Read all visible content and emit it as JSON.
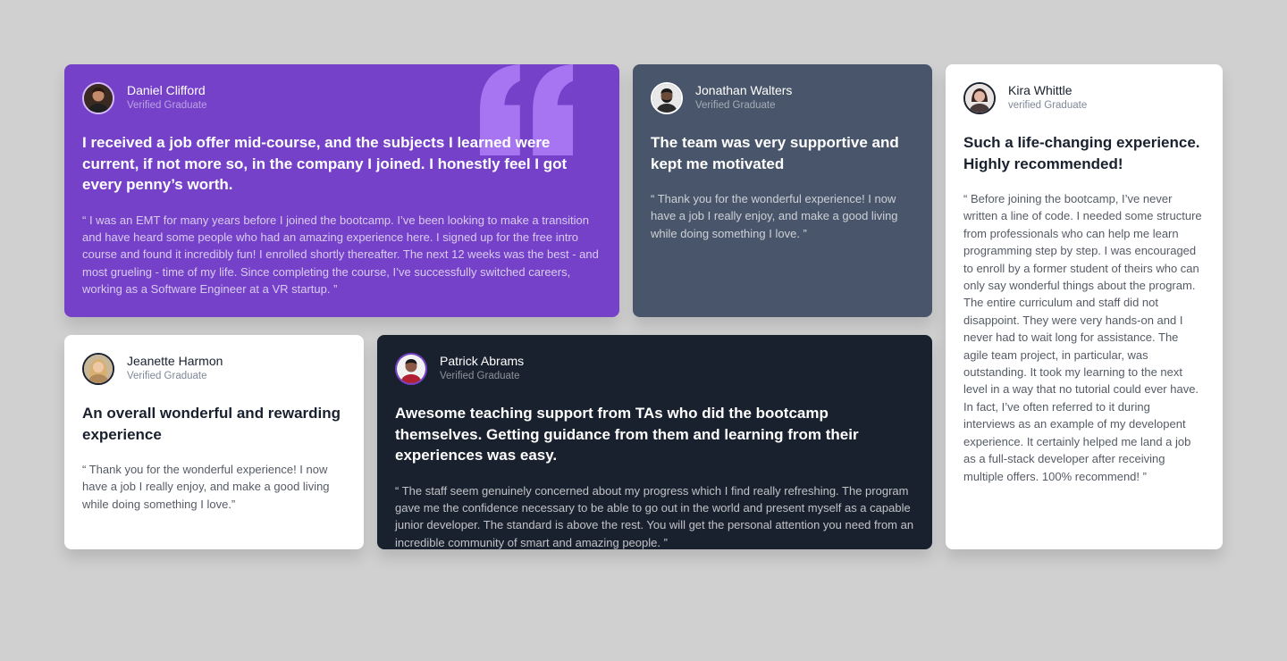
{
  "colors": {
    "background": "#d0d0d0",
    "moderate_violet": "#7541c8",
    "grayish_blue": "#48556a",
    "very_dark_blue": "#19212e",
    "white": "#ffffff",
    "quote_mark": "#a775f1"
  },
  "decor": {
    "quote_icon": "quotation-mark-icon"
  },
  "testimonials": [
    {
      "name": "Daniel Clifford",
      "role": "Verified Graduate",
      "headline": "I received a job offer mid-course, and the subjects I learned were current, if not more so, in the company I joined. I honestly feel I got every penny’s worth.",
      "body": "“ I was an EMT for many years before I joined the bootcamp. I’ve been looking to make a transition and have heard some people who had an amazing experience here. I signed up for the free intro course and found it incredibly fun! I enrolled shortly thereafter. The next 12 weeks was the best - and most grueling - time of my life. Since completing the course, I’ve successfully switched careers, working as a Software Engineer at a VR startup. ”"
    },
    {
      "name": "Jonathan Walters",
      "role": "Verified Graduate",
      "headline": "The team was very supportive and kept me motivated",
      "body": "“ Thank you for the wonderful experience! I now have a job I really enjoy, and make a good living while doing something I love. ”"
    },
    {
      "name": "Kira Whittle",
      "role": "verified Graduate",
      "headline": "Such a life-changing experience. Highly recommended!",
      "body": "“ Before joining the bootcamp, I’ve never written a line of code. I needed some structure from professionals who can help me learn programming step by step. I was encouraged to enroll by a former student of theirs who can only say wonderful things about the program. The entire curriculum and staff did not disappoint. They were very hands-on and I never had to wait long for assistance. The agile team project, in particular, was outstanding. It took my learning to the next level in a way that no tutorial could ever have. In fact, I’ve often referred to it during interviews as an example of my develop­ent experience. It certainly helped me land a job as a full-stack developer after receiving multiple offers. 100% recommend! ”"
    },
    {
      "name": "Jeanette Harmon",
      "role": "Verified Graduate",
      "headline": "An overall wonderful and rewarding experience",
      "body": "“ Thank you for the wonderful experience! I now have a job I really enjoy, and make a good living while doing something I love.”"
    },
    {
      "name": "Patrick Abrams",
      "role": "Verified Graduate",
      "headline": "Awesome teaching support from TAs who did the bootcamp themselves. Getting guidance from them and learning from their experiences was easy.",
      "body": "“ The staff seem genuinely concerned about my progress which I find really refreshing. The program gave me the confidence necessary to be able to go out in the world and present myself as a capable junior developer. The standard is above the rest. You will get the personal attention you need from an incredible community of smart and amazing people. ”"
    }
  ]
}
